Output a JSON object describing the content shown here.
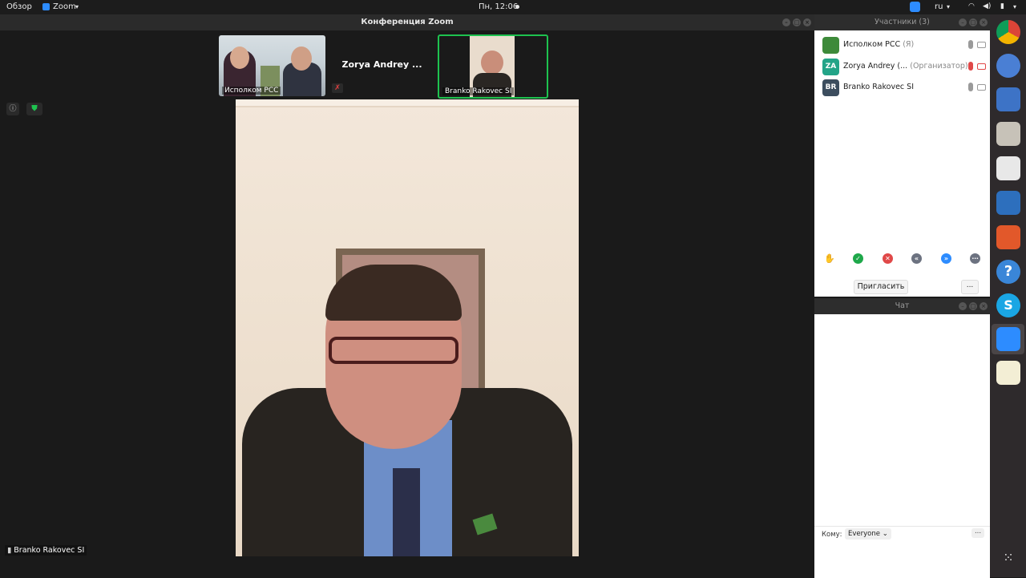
{
  "topbar": {
    "overview": "Обзор",
    "app": "Zoom",
    "clock": "Пн, 12:06",
    "lang": "ru"
  },
  "zoom_window": {
    "title": "Конференция Zoom",
    "thumbnails": [
      {
        "name": "Исполком РСС"
      },
      {
        "name": "Zorya Andrey ..."
      },
      {
        "name": "Branko Rakovec SI"
      }
    ],
    "active_speaker": "Branko Rakovec SI"
  },
  "participants": {
    "title": "Участники (3)",
    "list": [
      {
        "initials": "",
        "name": "Исполком РСС",
        "meta": "(Я)"
      },
      {
        "initials": "ZA",
        "name": "Zorya Andrey (...",
        "meta": "(Организатор)"
      },
      {
        "initials": "BR",
        "name": "Branko Rakovec SI",
        "meta": ""
      }
    ],
    "invite_label": "Пригласить",
    "more_label": "..."
  },
  "chat": {
    "title": "Чат",
    "to_label": "Кому:",
    "to_value": "Everyone",
    "more_label": "..."
  },
  "colors": {
    "accent_green": "#1ec24f",
    "zoom_blue": "#2d8cff",
    "avatar_za": "#23a488",
    "avatar_br": "#3c4d5e"
  }
}
